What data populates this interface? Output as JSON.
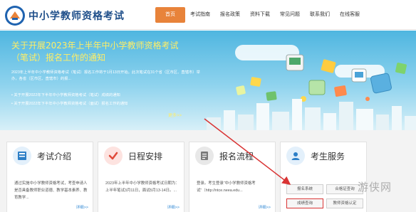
{
  "site": {
    "title": "中小学教师资格考试"
  },
  "nav": [
    {
      "label": "首页",
      "active": true
    },
    {
      "label": "考试指南",
      "active": false
    },
    {
      "label": "报名政策",
      "active": false
    },
    {
      "label": "资料下载",
      "active": false
    },
    {
      "label": "常见问题",
      "active": false
    },
    {
      "label": "联系我们",
      "active": false
    },
    {
      "label": "在线客服",
      "active": false
    }
  ],
  "banner": {
    "title": "关于开展2023年上半年中小学教师资格考试（笔试）报名工作的通知",
    "desc": "2023年上半年中小学教师资格考试（笔试）报名工作将于1月13日开始。此次笔试在31个省（区市区、直辖市）举办，各省（区市区、直辖市）的报...",
    "links": [
      "• 关于开展2022年下半年中小学教师资格考试（笔试）成绩的通知",
      "• 关于开展2022年下半年中小学教师资格考试（面试）报名工作的通知"
    ],
    "more": "更多>>"
  },
  "cards": [
    {
      "title": "考试介绍",
      "text": "通过实施中小学教师资格考试，考查申请人是否具备教师职业道德、教学基本素养、教育教学...",
      "more": "详细>>"
    },
    {
      "title": "日程安排",
      "text": "2023年上半年中小学教师资格考试日期为：上半年笔试3月11日，面试5月13-14日。...",
      "more": "详细>>"
    },
    {
      "title": "报名流程",
      "text": "登录。考生登录“中小学教师资格考试”（http://ntce.neea.edu...",
      "more": "详细>>"
    },
    {
      "title": "考生服务"
    }
  ],
  "services": [
    "报名系统",
    "合格证查询",
    "成绩查询",
    "教师资格认定"
  ],
  "watermark": "游侠网"
}
